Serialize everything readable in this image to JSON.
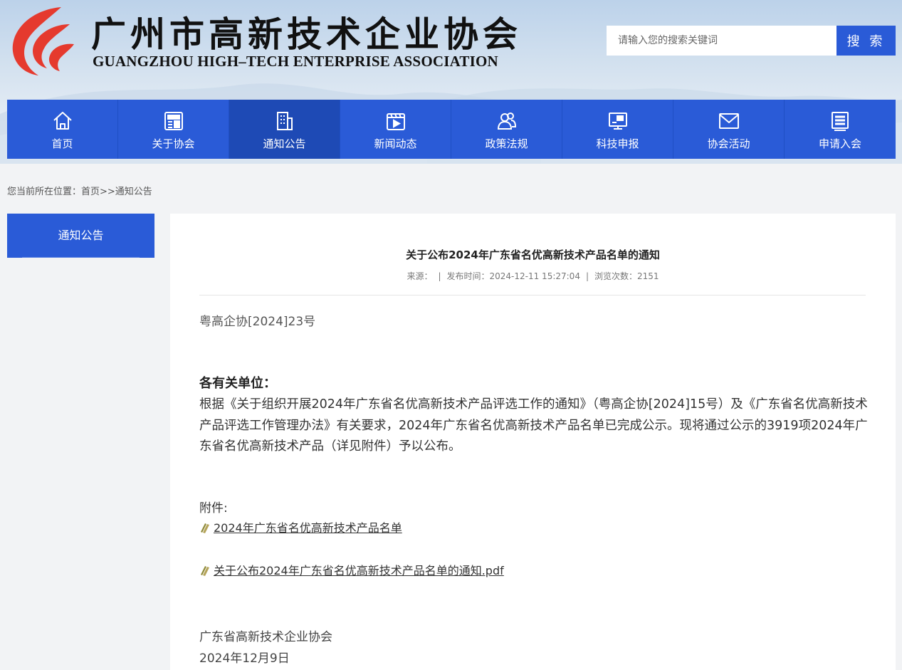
{
  "site": {
    "title_cn": "广州市高新技术企业协会",
    "title_en": "GUANGZHOU HIGH–TECH ENTERPRISE ASSOCIATION"
  },
  "search": {
    "placeholder": "请输入您的搜索关键词",
    "button_label": "搜 索"
  },
  "nav": {
    "items": [
      {
        "label": "首页",
        "icon": "home-icon"
      },
      {
        "label": "关于协会",
        "icon": "news-icon"
      },
      {
        "label": "通知公告",
        "icon": "building-icon",
        "active": true
      },
      {
        "label": "新闻动态",
        "icon": "video-icon"
      },
      {
        "label": "政策法规",
        "icon": "users-icon"
      },
      {
        "label": "科技申报",
        "icon": "card-icon"
      },
      {
        "label": "协会活动",
        "icon": "mail-icon"
      },
      {
        "label": "申请入会",
        "icon": "list-icon"
      }
    ]
  },
  "breadcrumb": {
    "text": "您当前所在位置：首页>>通知公告"
  },
  "sidebar": {
    "title": "通知公告"
  },
  "article": {
    "title": "关于公布2024年广东省名优高新技术产品名单的通知",
    "meta": {
      "source": "来源：",
      "publish_time": "发布时间：2024-12-11 15:27:04",
      "views": "浏览次数：2151"
    },
    "doc_number": "粤高企协[2024]23号",
    "salutation": "各有关单位：",
    "body": "根据《关于组织开展2024年广东省名优高新技术产品评选工作的通知》（粤高企协[2024]15号）及《广东省名优高新技术产品评选工作管理办法》有关要求，2024年广东省名优高新技术产品名单已完成公示。现将通过公示的3919项2024年广东省名优高新技术产品（详见附件）予以公布。",
    "attachments_label": "附件:",
    "attachments": [
      {
        "label": "2024年广东省名优高新技术产品名单"
      },
      {
        "label": "关于公布2024年广东省名优高新技术产品名单的通知.pdf"
      }
    ],
    "signature": {
      "org": "广东省高新技术企业协会",
      "date": "2024年12月9日"
    }
  },
  "colors": {
    "primary": "#2a5bd7",
    "active_nav": "#1e4ab5",
    "logo_red": "#e53a2e"
  }
}
